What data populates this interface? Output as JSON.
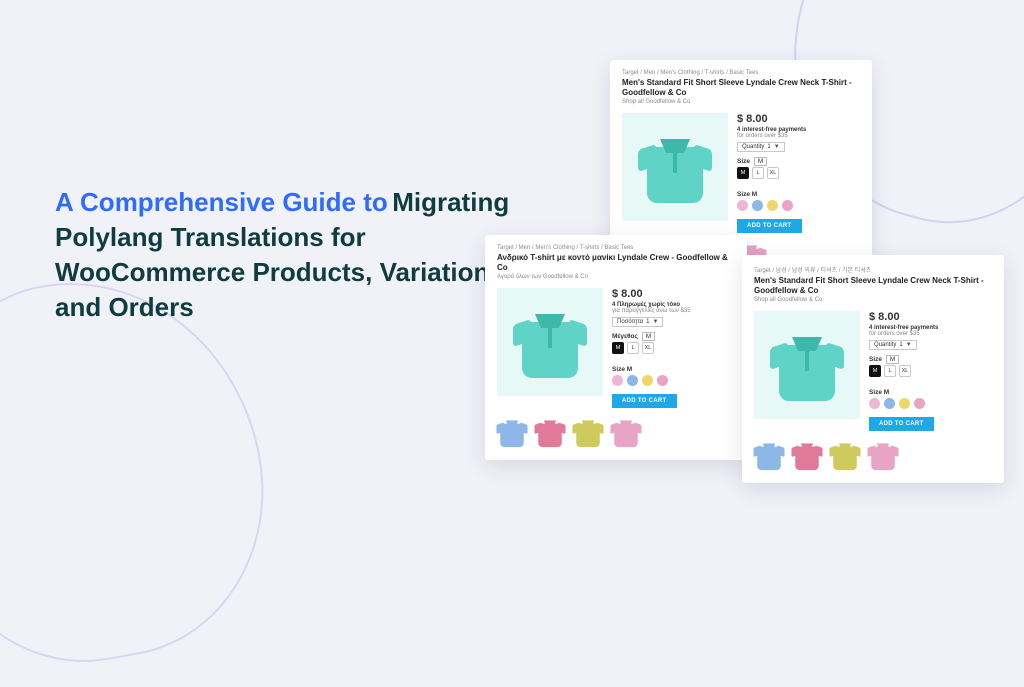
{
  "title": {
    "intro": "A Comprehensive Guide to",
    "body": "Migrating Polylang Translations for WooCommerce Products, Variations and Orders"
  },
  "cards": [
    {
      "breadcrumb": "Target / Men / Men's Clothing / T-shirts / Basic Tees",
      "product_title": "Men's Standard Fit Short Sleeve Lyndale Crew Neck T-Shirt - Goodfellow & Co",
      "shop_line": "Shop all Goodfellow & Co",
      "price": "$ 8.00",
      "payments_line": "4 interest-free payments",
      "payments_sub": "for orders over $35",
      "qty_label": "Quantity",
      "qty_value": "1",
      "size_label": "Size",
      "size_current": "M",
      "sizes": [
        "M",
        "L",
        "XL"
      ],
      "color_label": "Size M",
      "swatches": [
        "#efb5d6",
        "#8cb7e6",
        "#f0d56a",
        "#e8a4c5"
      ],
      "button": "ADD TO CART",
      "thumb_colors": [
        "#8cb7e6",
        "#e07a9a",
        "#cfca5e",
        "#e8a4c5"
      ]
    },
    {
      "breadcrumb": "Target / Men / Men's Clothing / T-shirts / Basic Tees",
      "product_title": "Ανδρικό T-shirt με κοντό μανίκι Lyndale Crew - Goodfellow & Co",
      "shop_line": "Αγορά όλων των Goodfellow & Co",
      "price": "$ 8.00",
      "payments_line": "4 Πληρωμές χωρίς τόκο",
      "payments_sub": "για παραγγελίες άνω των $35",
      "qty_label": "Ποσότητα",
      "qty_value": "1",
      "size_label": "Μέγεθος",
      "size_current": "M",
      "sizes": [
        "M",
        "L",
        "XL"
      ],
      "color_label": "Size M",
      "swatches": [
        "#efb5d6",
        "#8cb7e6",
        "#f0d56a",
        "#e8a4c5"
      ],
      "button": "ADD TO CART",
      "thumb_colors": [
        "#8cb7e6",
        "#e07a9a",
        "#cfca5e",
        "#e8a4c5"
      ]
    },
    {
      "breadcrumb": "Target / 남성 / 남성 의류 / 티셔츠 / 기본 티셔츠",
      "product_title": "Men's Standard Fit Short Sleeve Lyndale Crew Neck T-Shirt - Goodfellow & Co",
      "shop_line": "Shop all Goodfellow & Co",
      "price": "$ 8.00",
      "payments_line": "4 interest-free payments",
      "payments_sub": "for orders over $35",
      "qty_label": "Quantity",
      "qty_value": "1",
      "size_label": "Size",
      "size_current": "M",
      "sizes": [
        "M",
        "L",
        "XL"
      ],
      "color_label": "Size M",
      "swatches": [
        "#efb5d6",
        "#8cb7e6",
        "#f0d56a",
        "#e8a4c5"
      ],
      "button": "ADD TO CART",
      "thumb_colors": [
        "#8cb7e6",
        "#e07a9a",
        "#cfca5e",
        "#e8a4c5"
      ]
    }
  ]
}
